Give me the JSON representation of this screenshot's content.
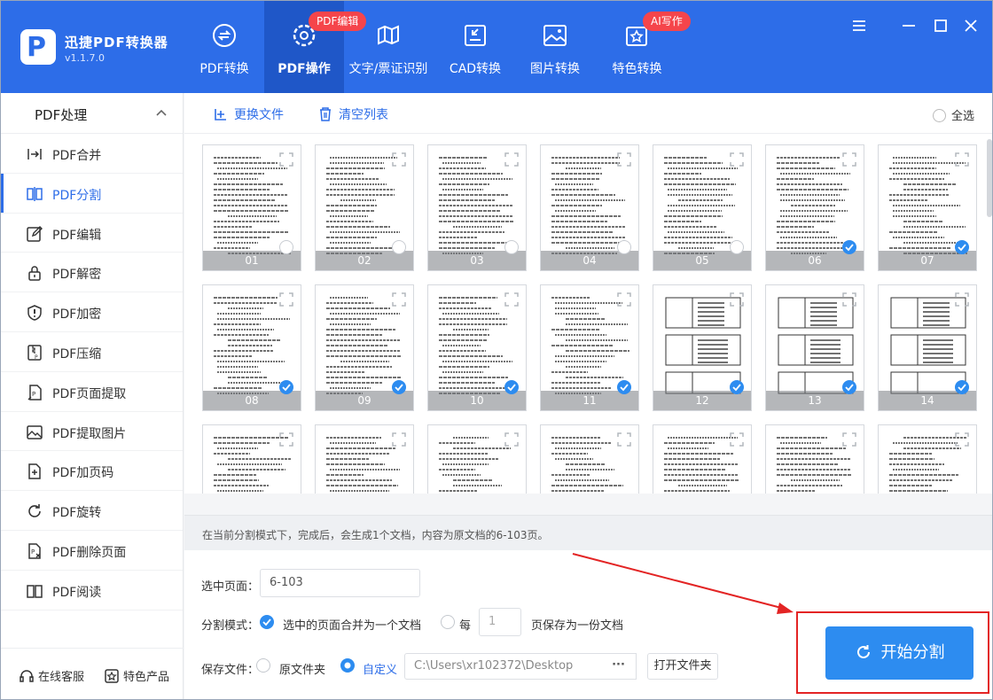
{
  "app": {
    "name": "迅捷PDF转换器",
    "version": "v1.1.7.0"
  },
  "nav": [
    {
      "label": "PDF转换",
      "icon": "convert-icon"
    },
    {
      "label": "PDF操作",
      "icon": "gear-icon",
      "badge": "PDF编辑",
      "active": true
    },
    {
      "label": "文字/票证识别",
      "icon": "scan-icon"
    },
    {
      "label": "CAD转换",
      "icon": "cad-icon"
    },
    {
      "label": "图片转换",
      "icon": "image-icon"
    },
    {
      "label": "特色转换",
      "icon": "star-icon",
      "badge": "AI写作"
    }
  ],
  "sidebar": {
    "title": "PDF处理",
    "items": [
      {
        "label": "PDF合并",
        "icon": "merge-icon"
      },
      {
        "label": "PDF分割",
        "icon": "split-icon",
        "active": true
      },
      {
        "label": "PDF编辑",
        "icon": "edit-icon"
      },
      {
        "label": "PDF解密",
        "icon": "unlock-icon"
      },
      {
        "label": "PDF加密",
        "icon": "shield-icon"
      },
      {
        "label": "PDF压缩",
        "icon": "compress-icon"
      },
      {
        "label": "PDF页面提取",
        "icon": "page-extract-icon"
      },
      {
        "label": "PDF提取图片",
        "icon": "image-extract-icon"
      },
      {
        "label": "PDF加页码",
        "icon": "page-number-icon"
      },
      {
        "label": "PDF旋转",
        "icon": "rotate-icon"
      },
      {
        "label": "PDF删除页面",
        "icon": "delete-page-icon"
      },
      {
        "label": "PDF阅读",
        "icon": "book-icon"
      }
    ],
    "footer": {
      "service": "在线客服",
      "products": "特色产品"
    }
  },
  "toolbar": {
    "replace_file": "更换文件",
    "clear_list": "清空列表",
    "select_all": "全选"
  },
  "pages": [
    {
      "n": "01",
      "selected": false
    },
    {
      "n": "02",
      "selected": false
    },
    {
      "n": "03",
      "selected": false
    },
    {
      "n": "04",
      "selected": false
    },
    {
      "n": "05",
      "selected": false
    },
    {
      "n": "06",
      "selected": true
    },
    {
      "n": "07",
      "selected": true
    },
    {
      "n": "08",
      "selected": true
    },
    {
      "n": "09",
      "selected": true
    },
    {
      "n": "10",
      "selected": true
    },
    {
      "n": "11",
      "selected": true
    },
    {
      "n": "12",
      "selected": true
    },
    {
      "n": "13",
      "selected": true
    },
    {
      "n": "14",
      "selected": true
    },
    {
      "n": "",
      "selected": false
    },
    {
      "n": "",
      "selected": false
    },
    {
      "n": "",
      "selected": false
    },
    {
      "n": "",
      "selected": false
    },
    {
      "n": "",
      "selected": false
    },
    {
      "n": "",
      "selected": false
    },
    {
      "n": "",
      "selected": false
    }
  ],
  "info": "在当前分割模式下，完成后，会生成1个文档，内容为原文档的6-103页。",
  "form": {
    "selected_pages_label": "选中页面：",
    "selected_pages_value": "6-103",
    "split_mode_label": "分割模式：",
    "mode_merge_label": "选中的页面合并为一个文档",
    "mode_every_prefix": "每",
    "mode_every_value": "1",
    "mode_every_suffix": "页保存为一份文档",
    "save_label": "保存文件：",
    "save_original": "原文件夹",
    "save_custom": "自定义",
    "save_path": "C:\\Users\\xr102372\\Desktop",
    "browse_label": "···",
    "open_folder": "打开文件夹",
    "start": "开始分割"
  },
  "colors": {
    "brand": "#2d6de8",
    "accent": "#2d8cf0",
    "badge": "#f5454b",
    "highlight": "#e32424"
  }
}
